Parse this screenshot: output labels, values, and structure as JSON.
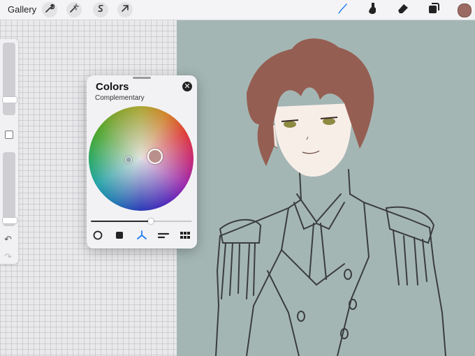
{
  "toolbar": {
    "gallery_label": "Gallery",
    "left_icons": [
      "wrench-icon",
      "magic-wand-icon",
      "selection-icon",
      "move-arrow-icon"
    ],
    "right_icons": [
      "brush-icon",
      "smudge-icon",
      "eraser-icon",
      "layers-icon"
    ],
    "active_tool": "brush-icon",
    "current_color": "#9a6a63"
  },
  "sidebar": {
    "brush_size": 0.2,
    "opacity": 0.05,
    "undo_icon": "undo-arrow-icon",
    "redo_icon": "redo-arrow-icon"
  },
  "colors_panel": {
    "title": "Colors",
    "mode": "Complementary",
    "close_icon": "close-icon",
    "brightness": 0.6,
    "tabs": [
      "disc-icon",
      "classic-icon",
      "harmony-icon",
      "value-icon",
      "palettes-icon"
    ],
    "active_tab": "harmony-icon",
    "accent_color": "#1e7cf2"
  },
  "canvas": {
    "background_color": "#a4b6b4",
    "hair_color": "#955e52"
  }
}
